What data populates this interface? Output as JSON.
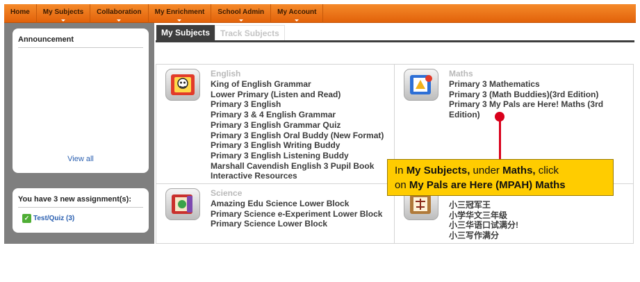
{
  "nav": {
    "items": [
      "Home",
      "My Subjects",
      "Collaboration",
      "My Enrichment",
      "School Admin",
      "My Account"
    ]
  },
  "sidebar": {
    "announcement_title": "Announcement",
    "view_all": "View all",
    "assignments_title": "You have 3 new assignment(s):",
    "quiz_label": "Test/Quiz (3)"
  },
  "tabs": {
    "active": "My Subjects",
    "inactive": "Track Subjects"
  },
  "subjects": {
    "english": {
      "heading": "English",
      "icon": "english-book-icon",
      "items": [
        "King of English Grammar",
        "Lower Primary (Listen and Read)",
        "Primary 3 English",
        "Primary 3 & 4 English Grammar",
        "Primary 3 English Grammar Quiz",
        "Primary 3 English Oral Buddy (New Format)",
        "Primary 3 English Writing Buddy",
        "Primary 3 English Listening Buddy",
        "Marshall Cavendish English 3 Pupil Book",
        "Interactive Resources"
      ]
    },
    "maths": {
      "heading": "Maths",
      "icon": "maths-book-icon",
      "items": [
        "Primary 3 Mathematics",
        "Primary 3 (Math Buddies)(3rd Edition)",
        "Primary 3 My Pals are Here! Maths (3rd Edition)"
      ]
    },
    "science": {
      "heading": "Science",
      "icon": "science-book-icon",
      "items": [
        "Amazing Edu Science Lower Block",
        "Primary Science e-Experiment Lower Block",
        "Primary Science Lower Block"
      ]
    },
    "chinese": {
      "icon": "chinese-book-icon",
      "items": [
        "小三冠军王",
        "小学华文三年级",
        "小三华语口试满分!",
        "小三写作满分"
      ]
    }
  },
  "callout": {
    "t1": "In ",
    "b1": "My Subjects,",
    "t2": " under ",
    "b2": "Maths,",
    "t3": " click",
    "t4": "on ",
    "b3": "My Pals are Here (MPAH) Maths"
  },
  "colors": {
    "nav_orange": "#f07a1f",
    "callout_yellow": "#ffcc00",
    "callout_red": "#d9001b"
  }
}
